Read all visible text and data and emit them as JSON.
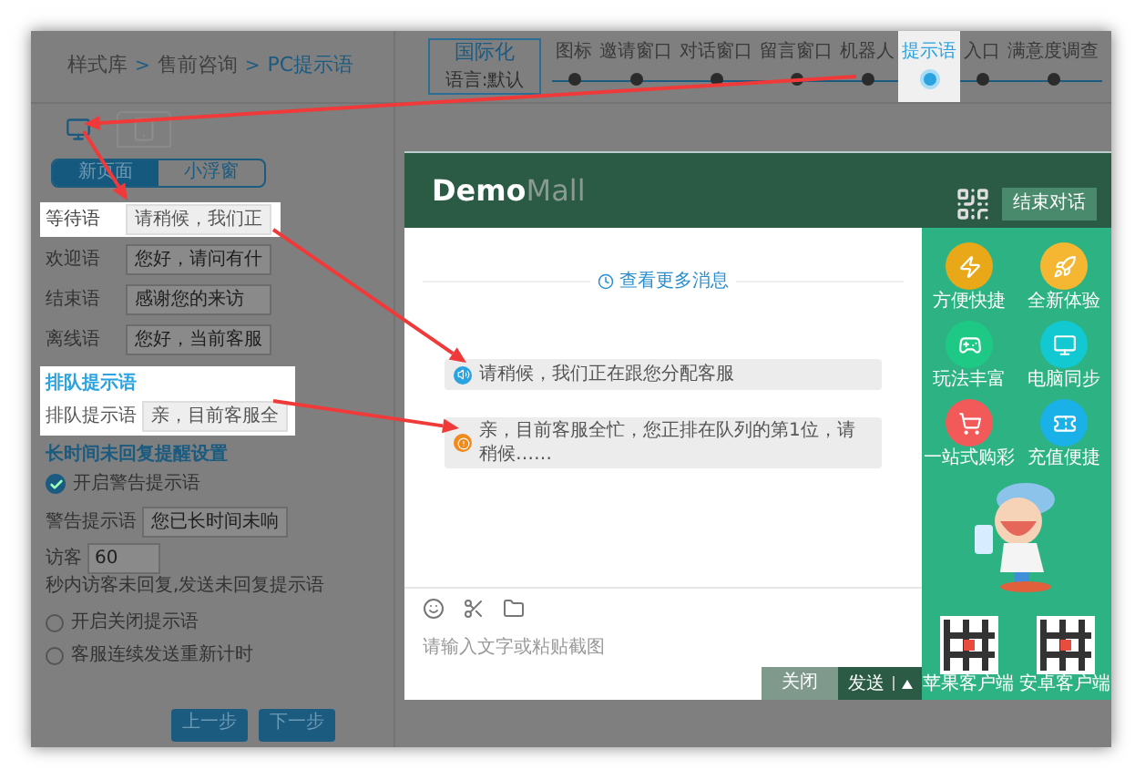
{
  "breadcrumb": [
    {
      "kind": "link",
      "label": "样式库"
    },
    {
      "kind": "separator",
      "label": ">"
    },
    {
      "kind": "link",
      "label": "售前咨询"
    },
    {
      "kind": "separator",
      "label": ">"
    },
    {
      "kind": "current",
      "label": "PC提示语"
    }
  ],
  "language_box": {
    "title": "国际化",
    "subtitle": "语言:默认"
  },
  "steps": [
    {
      "label": "图标",
      "selected": false
    },
    {
      "label": "邀请窗口",
      "selected": false
    },
    {
      "label": "对话窗口",
      "selected": false
    },
    {
      "label": "留言窗口",
      "selected": false
    },
    {
      "label": "机器人",
      "selected": false
    },
    {
      "label": "提示语",
      "selected": true
    },
    {
      "label": "入口",
      "selected": false
    },
    {
      "label": "满意度调查",
      "selected": false
    }
  ],
  "device_tabs": [
    {
      "kind": "desktop",
      "selected": true
    },
    {
      "kind": "tablet",
      "selected": false
    }
  ],
  "view_toggle": [
    {
      "label": "新页面",
      "selected": true
    },
    {
      "label": "小浮窗",
      "selected": false
    }
  ],
  "prompt_fields": [
    {
      "label": "等待语",
      "value": "请稍候，我们正",
      "highlighted": true
    },
    {
      "label": "欢迎语",
      "value": "您好，请问有什",
      "highlighted": false
    },
    {
      "label": "结束语",
      "value": "感谢您的来访",
      "highlighted": false
    },
    {
      "label": "离线语",
      "value": "您好，当前客服",
      "highlighted": false
    }
  ],
  "queue_section": {
    "title": "排队提示语",
    "highlighted": true,
    "label": "排队提示语",
    "value": "亲，目前客服全"
  },
  "reminder_section": {
    "title": "长时间未回复提醒设置",
    "warning_toggle": {
      "label": "开启警告提示语",
      "checked": true
    },
    "warning_field": {
      "label": "警告提示语",
      "value": "您已长时间未响"
    },
    "timeout": {
      "prefix": "访客",
      "value": "60",
      "suffix": "秒内访客未回复,发送未回复提示语"
    },
    "options": [
      {
        "label": "开启关闭提示语",
        "selected": false
      },
      {
        "label": "客服连续发送重新计时",
        "selected": false
      }
    ]
  },
  "footer_buttons": [
    "上一步",
    "下一步"
  ],
  "chat": {
    "logo": {
      "primary": "Demo",
      "secondary": "Mall"
    },
    "end_button": "结束对话",
    "more_link": "查看更多消息",
    "messages": [
      {
        "kind": "info",
        "text": "请稍候，我们正在跟您分配客服"
      },
      {
        "kind": "warning",
        "text": "亲，目前客服全忙，您正排在队列的第1位，请稍候……"
      }
    ],
    "input_placeholder": "请输入文字或粘贴截图",
    "close_button": "关闭",
    "send_button": "发送",
    "features": [
      {
        "kind": "bolt",
        "label": "方便快捷",
        "color": "#e8a817"
      },
      {
        "kind": "rocket",
        "label": "全新体验",
        "color": "#f5b731"
      },
      {
        "kind": "gamepad",
        "label": "玩法丰富",
        "color": "#1ec986"
      },
      {
        "kind": "monitor",
        "label": "电脑同步",
        "color": "#13c9d1"
      },
      {
        "kind": "cart",
        "label": "一站式购彩",
        "color": "#f25a5a"
      },
      {
        "kind": "ticket",
        "label": "充值便捷",
        "color": "#1ab0e8"
      }
    ],
    "qr_codes": [
      {
        "label": "苹果客户端"
      },
      {
        "label": "安卓客户端"
      }
    ]
  }
}
